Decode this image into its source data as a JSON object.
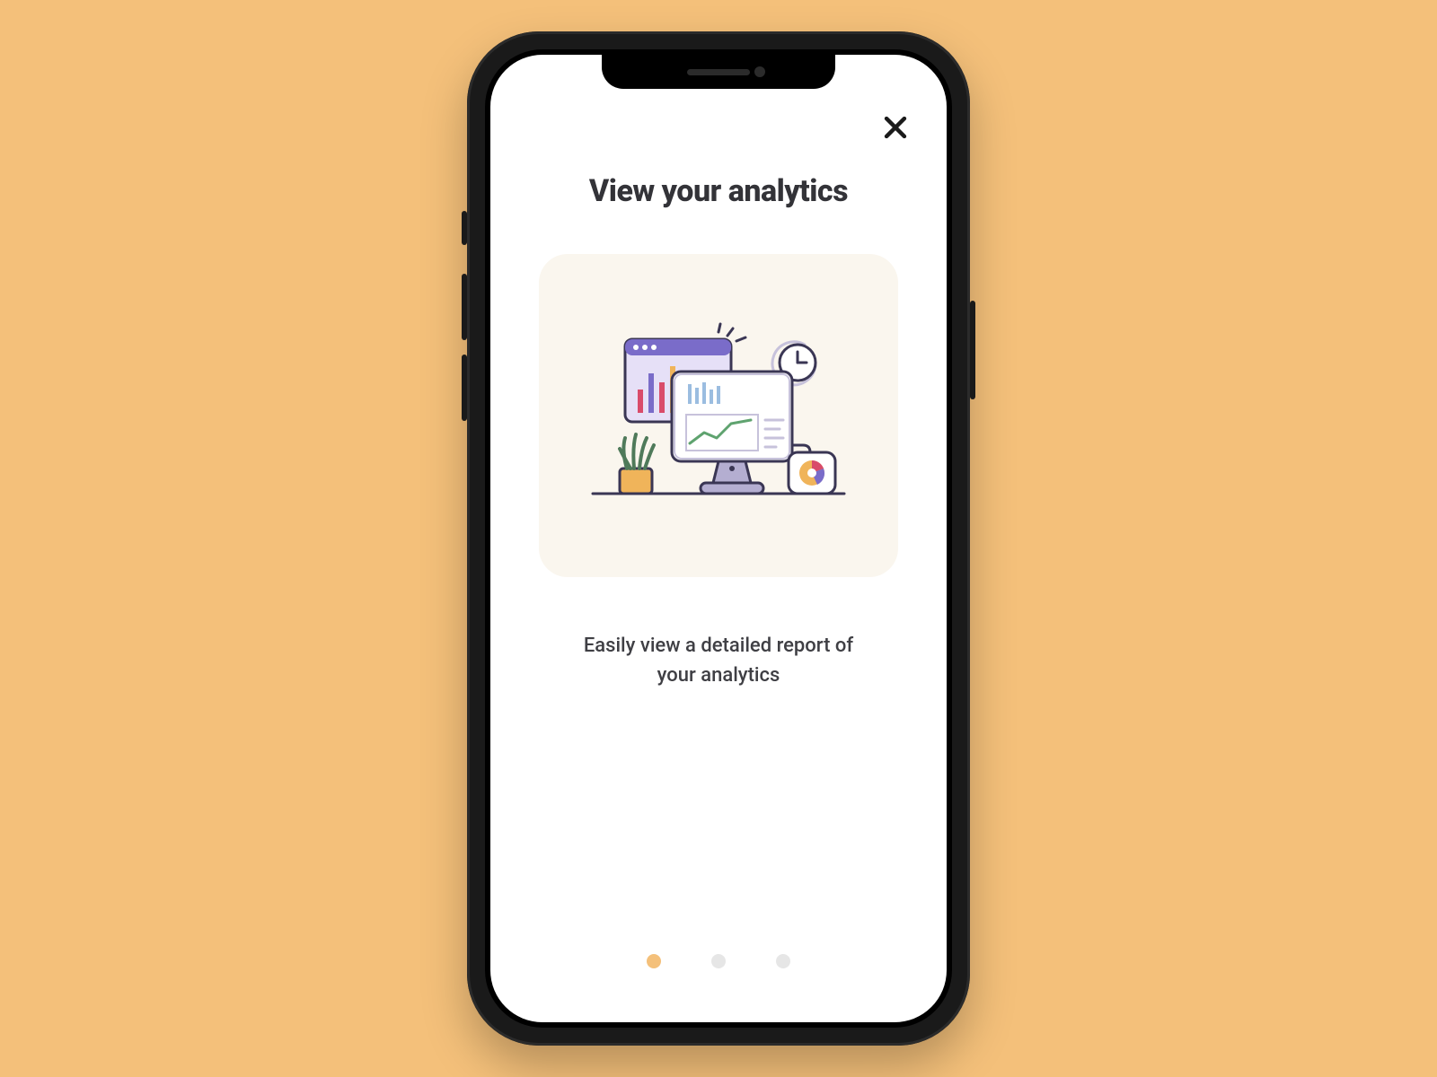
{
  "onboarding": {
    "title": "View your analytics",
    "subtitle": "Easily view a detailed report of your analytics",
    "illustration_name": "analytics-dashboard-illustration",
    "page_count": 3,
    "active_page_index": 0
  },
  "colors": {
    "background": "#f4c07a",
    "card": "#faf6ee",
    "text_primary": "#333338",
    "text_secondary": "#3f3f44",
    "dot_active": "#f4c07a",
    "dot_inactive": "#e6e6e6"
  }
}
